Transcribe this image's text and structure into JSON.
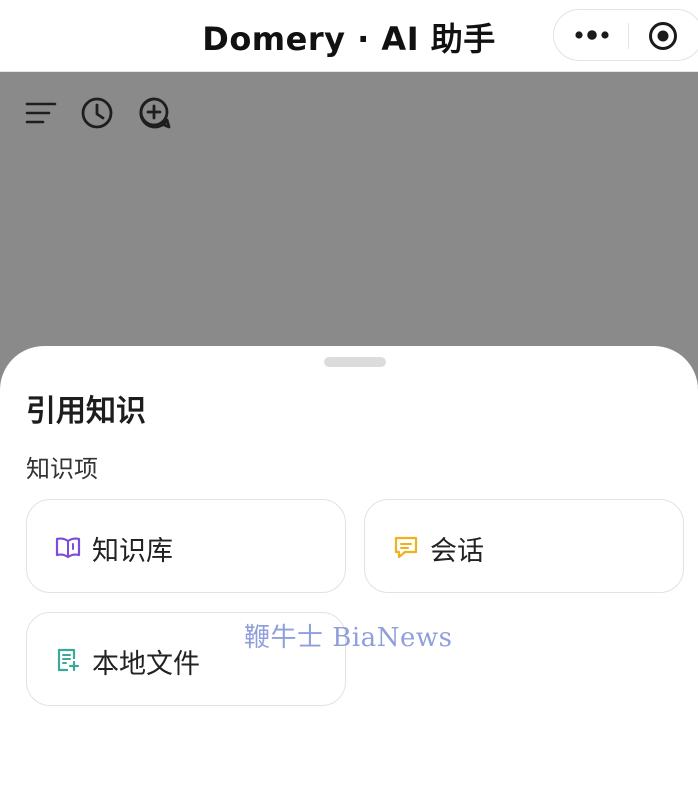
{
  "header": {
    "title": "Domery · AI 助手"
  },
  "toolbar": {
    "icons": [
      "menu-icon",
      "history-clock-icon",
      "new-chat-plus-icon"
    ]
  },
  "sheet": {
    "title": "引用知识",
    "section_label": "知识项",
    "options": [
      {
        "label": "知识库",
        "icon": "book-icon",
        "color": "#7c4ddb"
      },
      {
        "label": "会话",
        "icon": "chat-bubble-icon",
        "color": "#f0b21a"
      },
      {
        "label": "本地文件",
        "icon": "file-add-icon",
        "color": "#3aa99b"
      }
    ]
  },
  "watermark": "鞭牛士 BiaNews",
  "colors": {
    "overlay": "#8a8a8a",
    "background": "#ffffff"
  }
}
